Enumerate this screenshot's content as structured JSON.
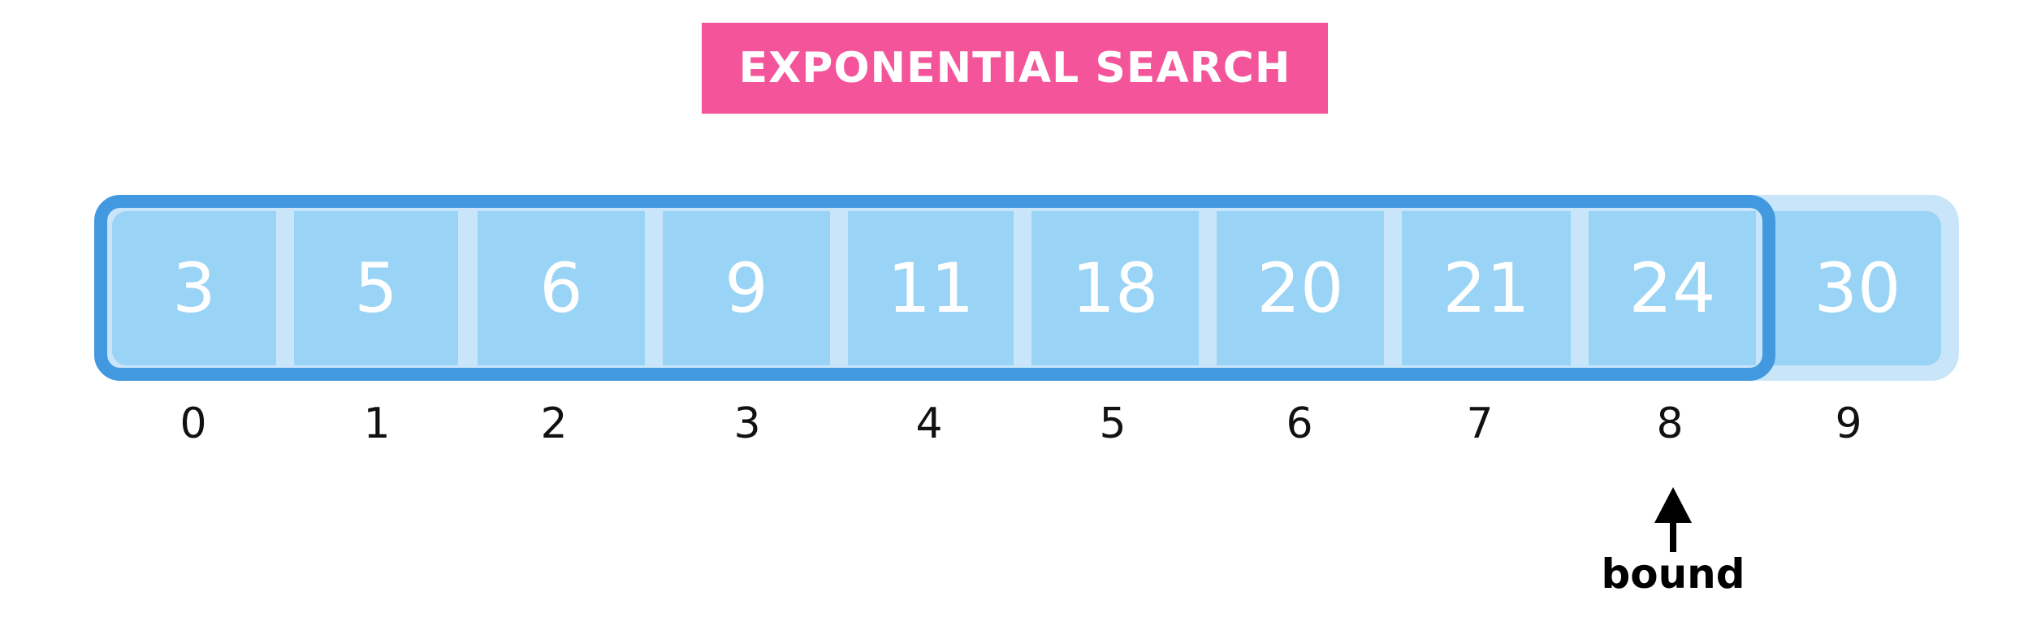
{
  "title": "EXPONENTIAL SEARCH",
  "array": {
    "values": [
      "3",
      "5",
      "6",
      "9",
      "11",
      "18",
      "20",
      "21",
      "24",
      "30"
    ],
    "indices": [
      "0",
      "1",
      "2",
      "3",
      "4",
      "5",
      "6",
      "7",
      "8",
      "9"
    ],
    "bounded_through_index": 8
  },
  "pointer_label": "bound",
  "colors": {
    "title_background": "#F4559A",
    "cell_fill": "#99D4F6",
    "cell_background": "#C9E5FA",
    "bound_outline": "#4299DF"
  }
}
